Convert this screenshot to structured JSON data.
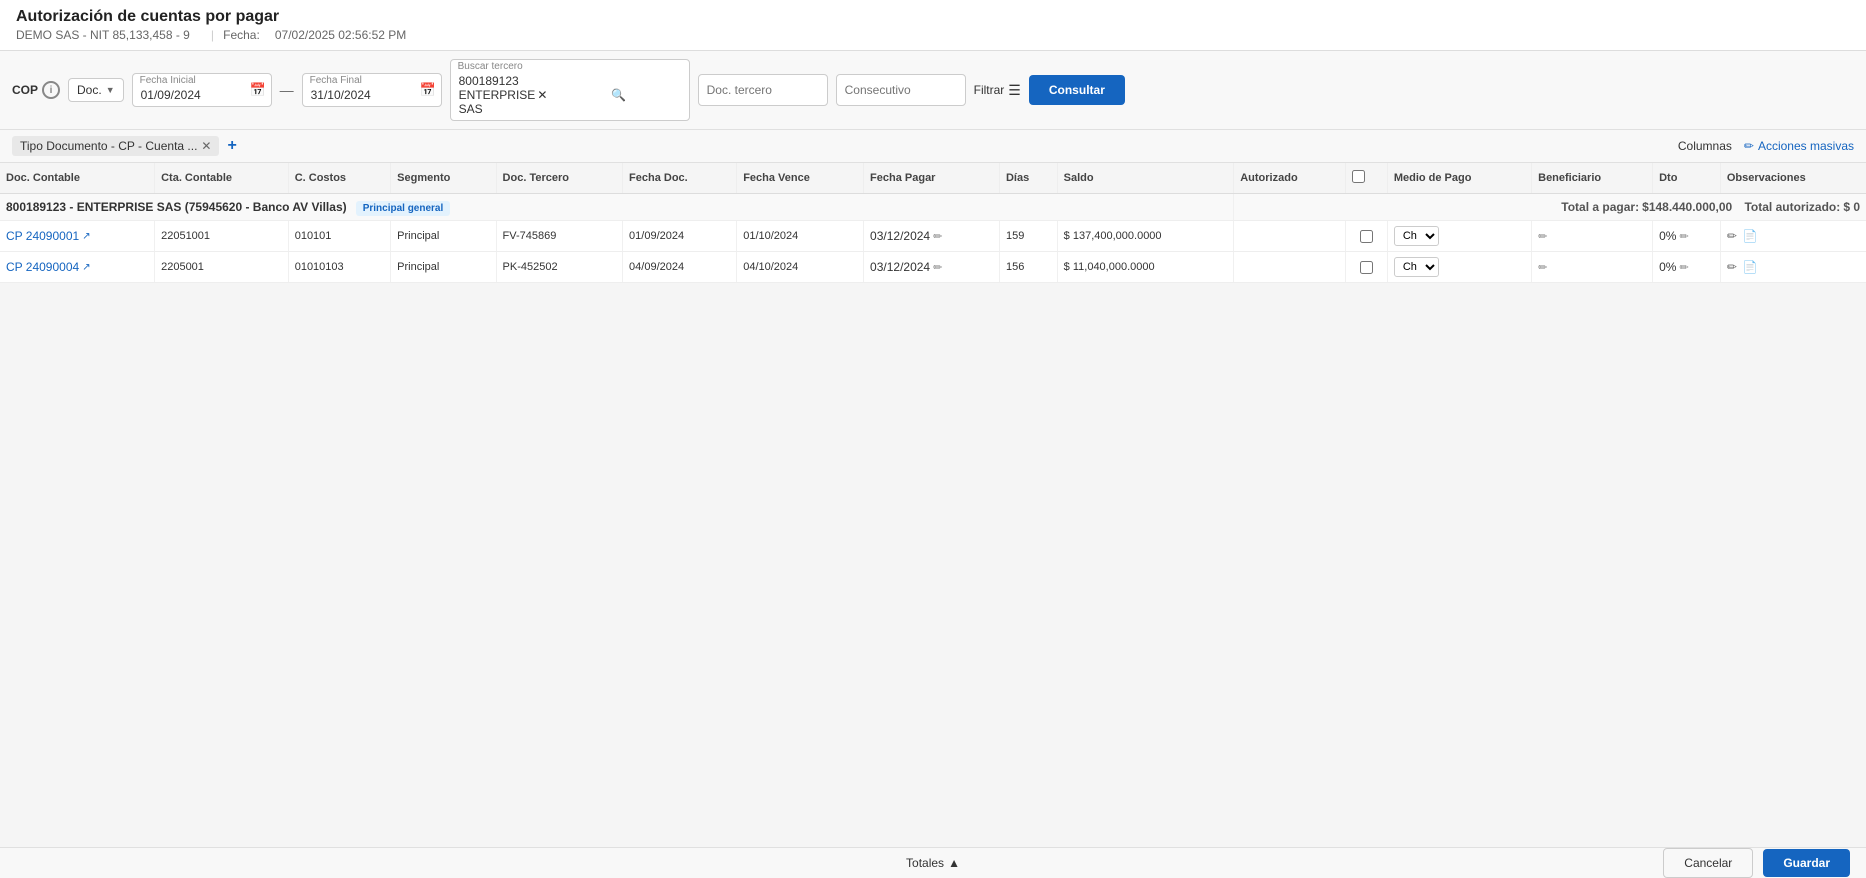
{
  "app": {
    "title": "Autorización de cuentas por pagar",
    "company": "DEMO SAS - NIT 85,133,458 - 9",
    "date_label": "Fecha:",
    "date_value": "07/02/2025 02:56:52 PM"
  },
  "toolbar": {
    "cop_label": "COP",
    "info_icon": "ℹ",
    "doc_label": "Doc.",
    "fecha_inicial_label": "Fecha Inicial",
    "fecha_inicial_value": "01/09/2024",
    "fecha_final_label": "Fecha Final",
    "fecha_final_value": "31/10/2024",
    "buscar_tercero_label": "Buscar tercero",
    "buscar_tercero_value": "800189123 ENTERPRISE SAS",
    "doc_tercero_placeholder": "Doc. tercero",
    "consecutivo_placeholder": "Consecutivo",
    "filtrar_label": "Filtrar",
    "consultar_label": "Consultar"
  },
  "filter_tags": {
    "tag_label": "Tipo Documento - CP - Cuenta ...",
    "columns_label": "Columnas",
    "acciones_label": "Acciones masivas"
  },
  "table": {
    "headers": [
      "Doc. Contable",
      "Cta. Contable",
      "C. Costos",
      "Segmento",
      "Doc. Tercero",
      "Fecha Doc.",
      "Fecha Vence",
      "Fecha Pagar",
      "Días",
      "Saldo",
      "Autorizado",
      "",
      "Medio de Pago",
      "Beneficiario",
      "Dto",
      "Observaciones"
    ],
    "group_row": {
      "label": "800189123 - ENTERPRISE SAS (75945620 - Banco AV Villas)",
      "badge": "Principal general",
      "totals_label": "Total a pagar:",
      "totals_value": "$148.440.000,00",
      "total_autorizado_label": "Total autorizado:",
      "total_autorizado_value": "$ 0"
    },
    "rows": [
      {
        "doc_contable": "CP 24090001",
        "cta_contable": "22051001",
        "c_costos": "010101",
        "segmento": "Principal",
        "doc_tercero": "FV-745869",
        "fecha_doc": "01/09/2024",
        "fecha_vence": "01/10/2024",
        "fecha_vence_red": true,
        "fecha_pagar": "03/12/2024",
        "dias": "159",
        "saldo": "$ 137,400,000.0000",
        "medio_pago": "Ch",
        "dto_value": "0%"
      },
      {
        "doc_contable": "CP 24090004",
        "cta_contable": "2205001",
        "c_costos": "01010103",
        "segmento": "Principal",
        "doc_tercero": "PK-452502",
        "fecha_doc": "04/09/2024",
        "fecha_vence": "04/10/2024",
        "fecha_vence_red": true,
        "fecha_pagar": "03/12/2024",
        "dias": "156",
        "saldo": "$ 11,040,000.0000",
        "medio_pago": "Ch",
        "dto_value": "0%"
      }
    ]
  },
  "footer": {
    "totales_label": "Totales",
    "chevron_icon": "▲",
    "cancel_label": "Cancelar",
    "guardar_label": "Guardar"
  }
}
